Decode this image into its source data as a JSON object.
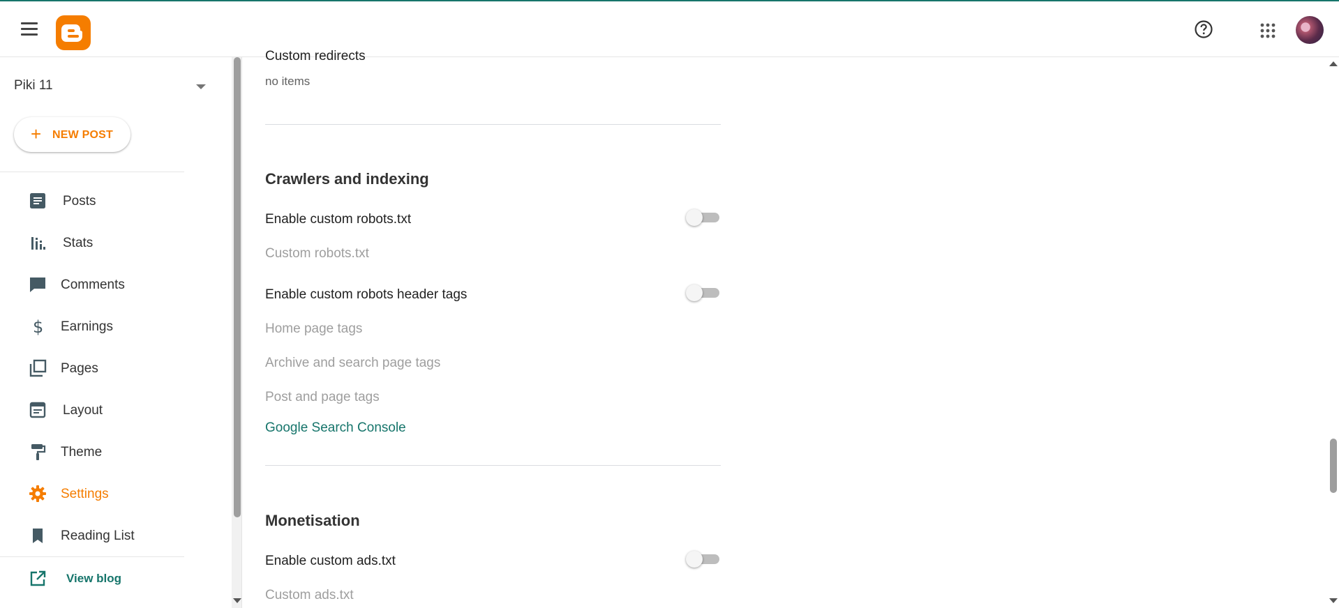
{
  "sidebar": {
    "blog_name": "Piki 11",
    "new_post_label": "NEW POST",
    "items": [
      {
        "label": "Posts"
      },
      {
        "label": "Stats"
      },
      {
        "label": "Comments"
      },
      {
        "label": "Earnings"
      },
      {
        "label": "Pages"
      },
      {
        "label": "Layout"
      },
      {
        "label": "Theme"
      },
      {
        "label": "Settings"
      },
      {
        "label": "Reading List"
      }
    ],
    "view_blog_label": "View blog"
  },
  "main": {
    "redirects": {
      "title": "Custom redirects",
      "value": "no items"
    },
    "crawlers": {
      "title": "Crawlers and indexing",
      "robots_toggle_label": "Enable custom robots.txt",
      "robots_toggle_on": false,
      "robots_txt": "Custom robots.txt",
      "header_tags_toggle_label": "Enable custom robots header tags",
      "header_tags_toggle_on": false,
      "home_page_tags": "Home page tags",
      "archive_tags": "Archive and search page tags",
      "post_tags": "Post and page tags",
      "search_console_link": "Google Search Console"
    },
    "monetisation": {
      "title": "Monetisation",
      "ads_toggle_label": "Enable custom ads.txt",
      "ads_toggle_on": false,
      "ads_txt": "Custom ads.txt"
    }
  },
  "colors": {
    "accent": "#f57d00",
    "link": "#16756b",
    "muted": "#9e9e9e"
  }
}
